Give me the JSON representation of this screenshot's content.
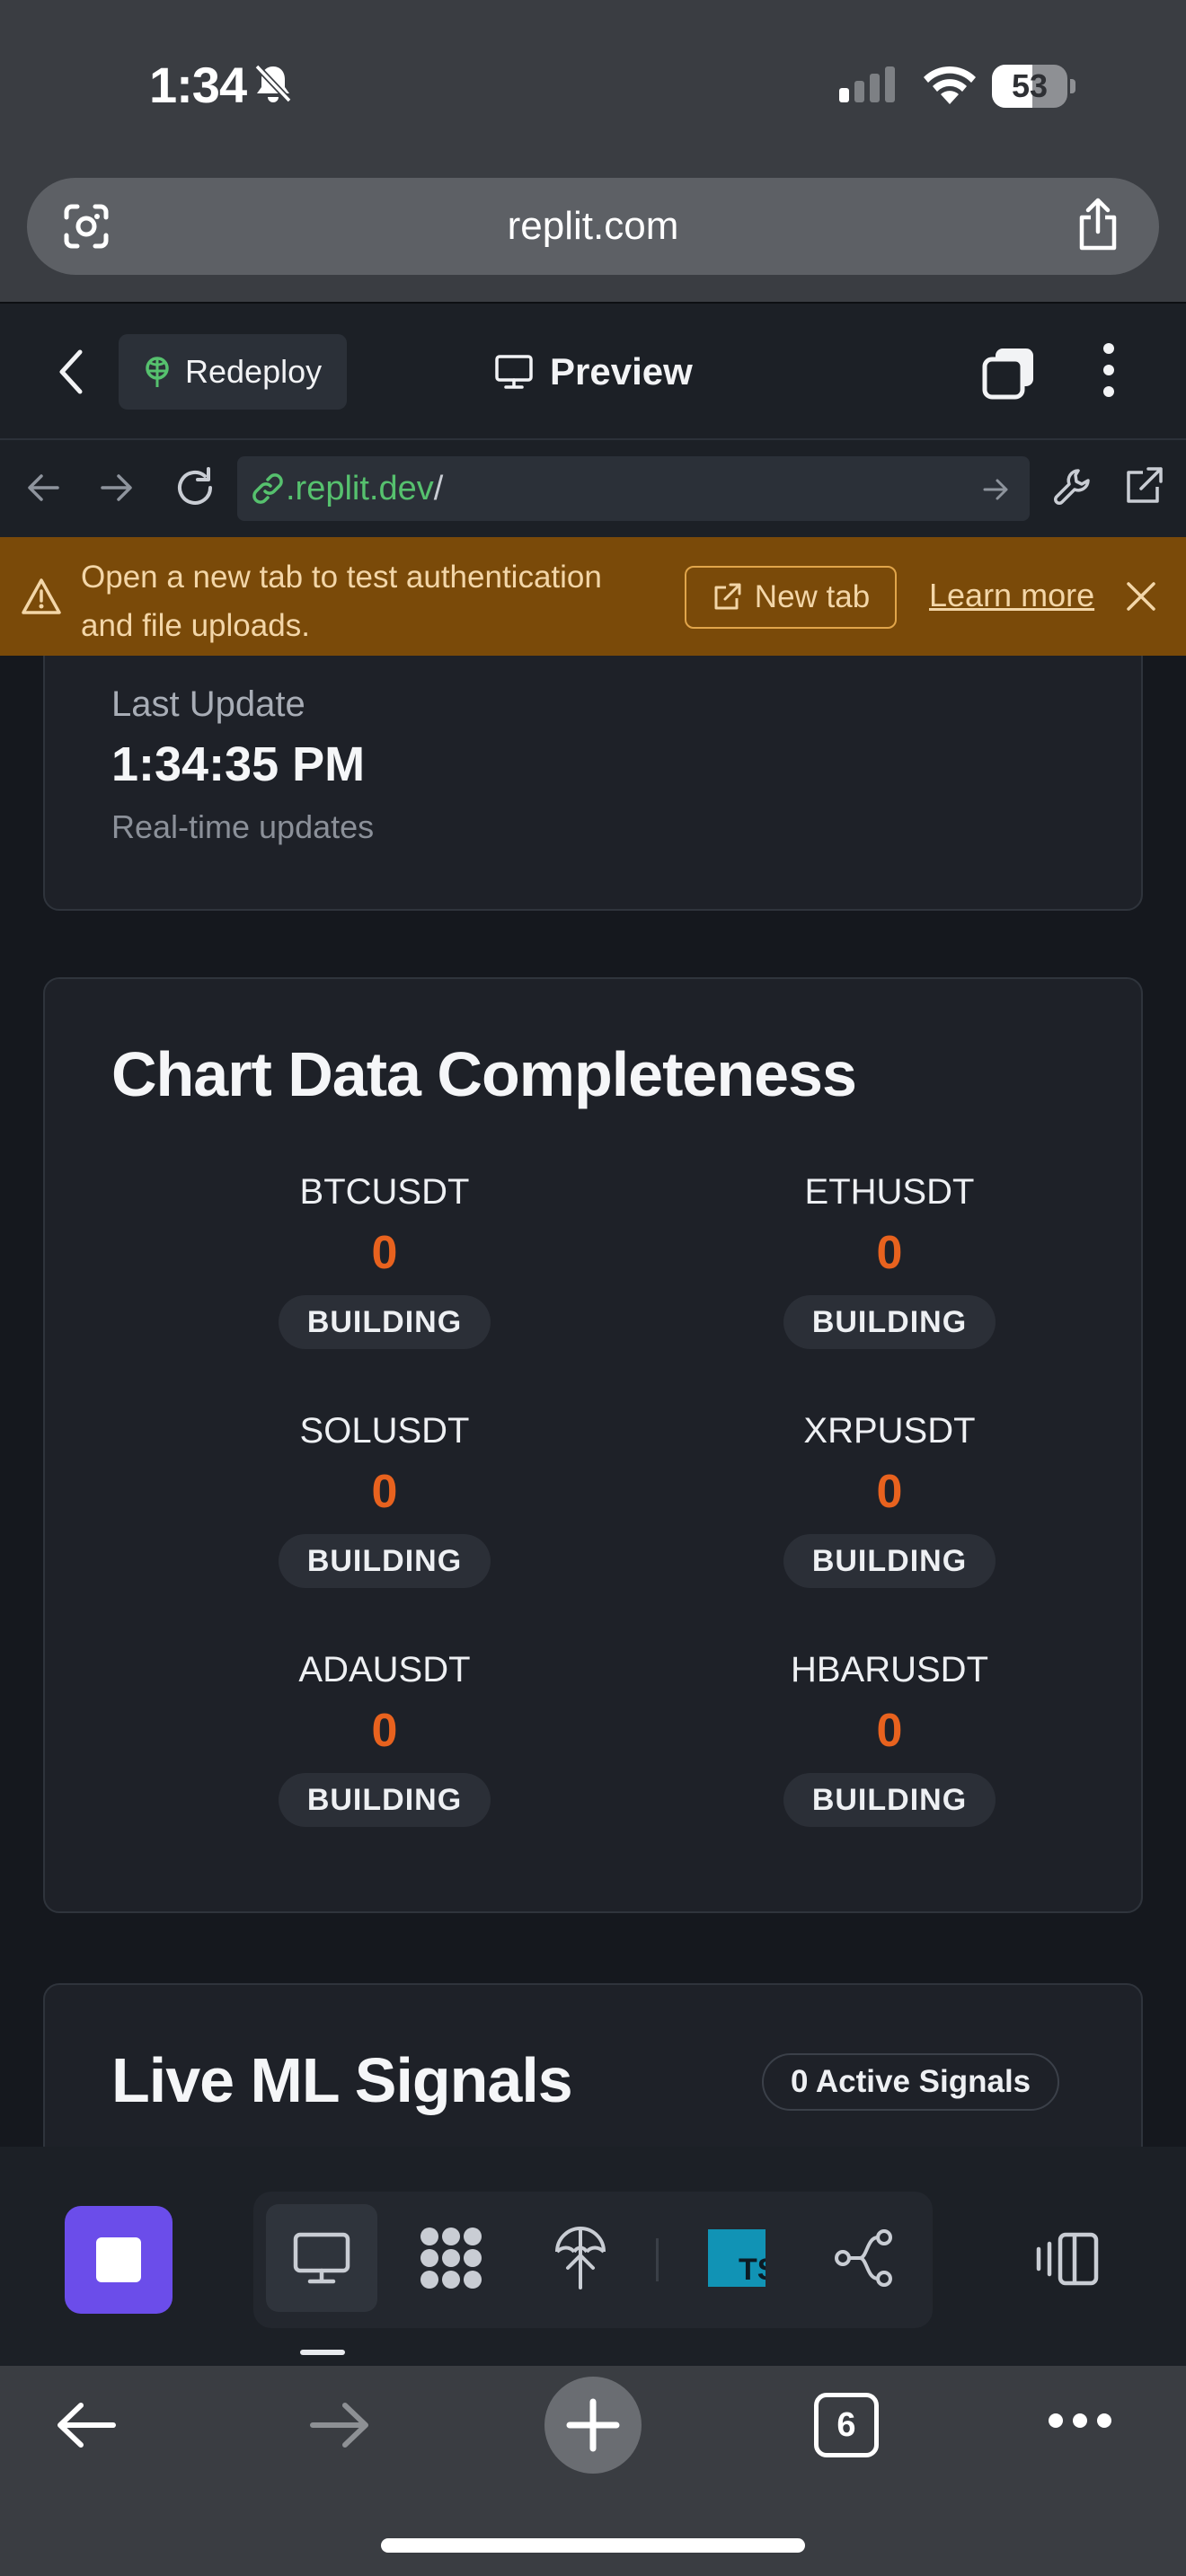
{
  "status_bar": {
    "time": "1:34",
    "battery": "53",
    "battery_level": 0.53,
    "signal_bars": 1
  },
  "safari": {
    "url_host": "replit.com",
    "tab_count": "6"
  },
  "replit_header": {
    "redeploy_label": "Redeploy",
    "title": "Preview"
  },
  "browser": {
    "address_host": ".replit.dev",
    "address_path": "/"
  },
  "banner": {
    "message": "Open a new tab to test authentication and file uploads.",
    "new_tab_label": "New tab",
    "learn_more_label": "Learn more",
    "color": "#7a4a09"
  },
  "last_update": {
    "label": "Last Update",
    "value": "1:34:35 PM",
    "subtitle": "Real-time updates"
  },
  "chart_completeness": {
    "title": "Chart Data Completeness",
    "symbols": [
      {
        "name": "BTCUSDT",
        "count": "0",
        "status": "BUILDING"
      },
      {
        "name": "ETHUSDT",
        "count": "0",
        "status": "BUILDING"
      },
      {
        "name": "SOLUSDT",
        "count": "0",
        "status": "BUILDING"
      },
      {
        "name": "XRPUSDT",
        "count": "0",
        "status": "BUILDING"
      },
      {
        "name": "ADAUSDT",
        "count": "0",
        "status": "BUILDING"
      },
      {
        "name": "HBARUSDT",
        "count": "0",
        "status": "BUILDING"
      }
    ],
    "count_color": "#e8621e"
  },
  "ml_signals": {
    "title": "Live ML Signals",
    "badge": "0 Active Signals"
  },
  "toolbar": {
    "accent": "#6b4dea",
    "tools": [
      "monitor-icon",
      "nodes-icon",
      "deploy-icon",
      "typescript-icon",
      "git-branch-icon"
    ],
    "ts_label": "TS"
  }
}
